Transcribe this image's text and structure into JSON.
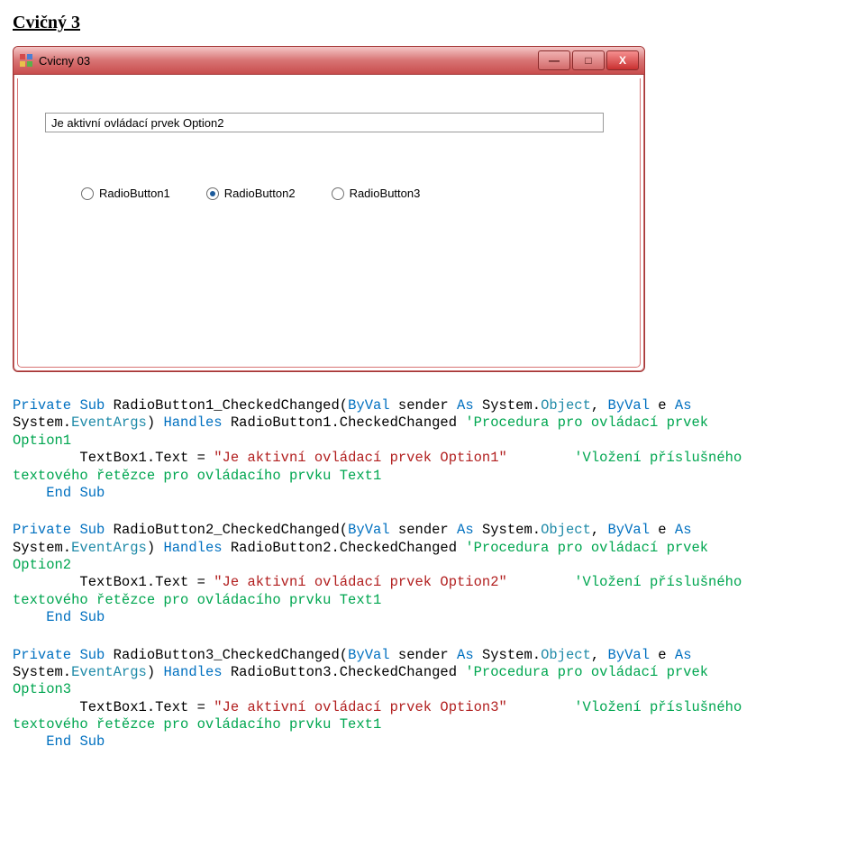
{
  "heading": "Cvičný 3",
  "form": {
    "title": "Cvicny 03",
    "textbox_value": "Je aktivní ovládací prvek Option2",
    "radios": [
      {
        "label": "RadioButton1",
        "checked": false
      },
      {
        "label": "RadioButton2",
        "checked": true
      },
      {
        "label": "RadioButton3",
        "checked": false
      }
    ],
    "btn_min": "—",
    "btn_max": "□",
    "btn_close": "X"
  },
  "code1": {
    "l1a": "Private",
    "l1b": "Sub",
    "l1c": " RadioButton1_CheckedChanged(",
    "l1d": "ByVal",
    "l1e": " sender ",
    "l1f": "As",
    "l1g": " System.",
    "l1h": "Object",
    "l1i": ", ",
    "l1j": "ByVal",
    "l1k": " e ",
    "l1l": "As",
    "l2a": "System.",
    "l2b": "EventArgs",
    "l2c": ") ",
    "l2d": "Handles",
    "l2e": " RadioButton1.CheckedChanged ",
    "l2f": "'Procedura pro ovládací prvek",
    "l3a": "Option1",
    "l4a": "        TextBox1.Text = ",
    "l4b": "\"Je aktivní ovládací prvek Option1\"",
    "l4c": "        ",
    "l4d": "'Vložení příslušného",
    "l5a": "textového řetězce pro ovládacího prvku Text1",
    "l6a": "    ",
    "l6b": "End",
    "l6c": " ",
    "l6d": "Sub"
  },
  "code2": {
    "l1a": "Private",
    "l1b": "Sub",
    "l1c": " RadioButton2_CheckedChanged(",
    "l1d": "ByVal",
    "l1e": " sender ",
    "l1f": "As",
    "l1g": " System.",
    "l1h": "Object",
    "l1i": ", ",
    "l1j": "ByVal",
    "l1k": " e ",
    "l1l": "As",
    "l2a": "System.",
    "l2b": "EventArgs",
    "l2c": ") ",
    "l2d": "Handles",
    "l2e": " RadioButton2.CheckedChanged ",
    "l2f": "'Procedura pro ovládací prvek",
    "l3a": "Option2",
    "l4a": "        TextBox1.Text = ",
    "l4b": "\"Je aktivní ovládací prvek Option2\"",
    "l4c": "        ",
    "l4d": "'Vložení příslušného",
    "l5a": "textového řetězce pro ovládacího prvku Text1",
    "l6a": "    ",
    "l6b": "End",
    "l6c": " ",
    "l6d": "Sub"
  },
  "code3": {
    "l1a": "Private",
    "l1b": "Sub",
    "l1c": " RadioButton3_CheckedChanged(",
    "l1d": "ByVal",
    "l1e": " sender ",
    "l1f": "As",
    "l1g": " System.",
    "l1h": "Object",
    "l1i": ", ",
    "l1j": "ByVal",
    "l1k": " e ",
    "l1l": "As",
    "l2a": "System.",
    "l2b": "EventArgs",
    "l2c": ") ",
    "l2d": "Handles",
    "l2e": " RadioButton3.CheckedChanged ",
    "l2f": "'Procedura pro ovládací prvek",
    "l3a": "Option3",
    "l4a": "        TextBox1.Text = ",
    "l4b": "\"Je aktivní ovládací prvek Option3\"",
    "l4c": "        ",
    "l4d": "'Vložení příslušného",
    "l5a": "textového řetězce pro ovládacího prvku Text1",
    "l6a": "    ",
    "l6b": "End",
    "l6c": " ",
    "l6d": "Sub"
  }
}
